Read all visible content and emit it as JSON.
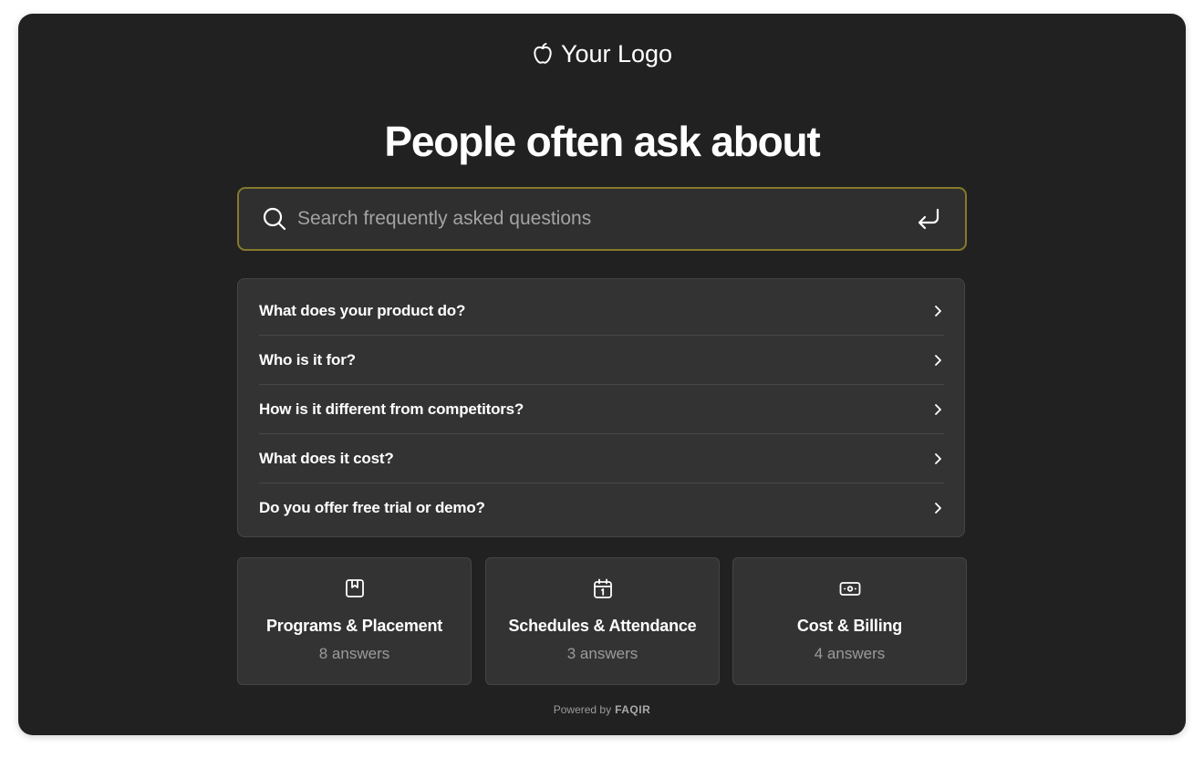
{
  "logo": {
    "icon": "apple-icon",
    "text": "Your Logo"
  },
  "heading": "People often ask about",
  "search": {
    "placeholder": "Search frequently asked questions",
    "value": "",
    "search_icon": "search-icon",
    "submit_icon": "enter-icon",
    "focus_border_color": "#857a2a"
  },
  "faq": {
    "items": [
      {
        "question": "What does your product do?"
      },
      {
        "question": "Who is it for?"
      },
      {
        "question": "How is it different from competitors?"
      },
      {
        "question": "What does it cost?"
      },
      {
        "question": "Do you offer free trial or demo?"
      }
    ],
    "chevron_icon": "chevron-right-icon"
  },
  "categories": [
    {
      "icon": "bookmark-box-icon",
      "title": "Programs & Placement",
      "count": "8 answers"
    },
    {
      "icon": "calendar-icon",
      "title": "Schedules & Attendance",
      "count": "3 answers"
    },
    {
      "icon": "money-icon",
      "title": "Cost & Billing",
      "count": "4 answers"
    }
  ],
  "footer": {
    "prefix": "Powered by",
    "brand": "FAQIR"
  },
  "colors": {
    "background": "#212121",
    "panel": "#333333",
    "border": "#454545",
    "text": "#ffffff",
    "muted": "#9b9b9b"
  }
}
